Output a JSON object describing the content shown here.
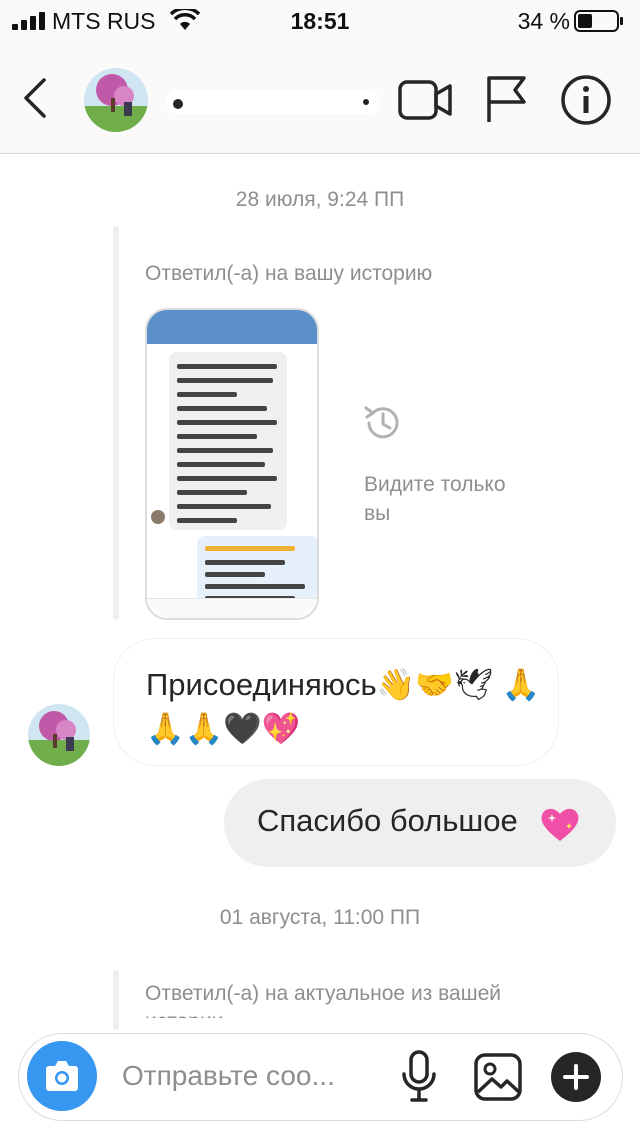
{
  "status_bar": {
    "carrier": "MTS RUS",
    "time": "18:51",
    "battery": "34 %"
  },
  "header": {
    "username": "",
    "icons": [
      "back-icon",
      "video-call-icon",
      "flag-icon",
      "info-icon"
    ]
  },
  "thread": {
    "date_1": "28 июля, 9:24 ПП",
    "story_reply_label": "Ответил(-а) на вашу историю",
    "only_you_see": "Видите только вы",
    "incoming_message": "Присоединяюсь👋🤝🕊 🙏🙏🙏🖤💖",
    "outgoing_message": "Спасибо большое",
    "date_2": "01 августа, 11:00 ПП",
    "highlight_reply_label": "Ответил(-а) на актуальное из вашей истории"
  },
  "composer": {
    "placeholder": "Отправьте соо..."
  },
  "colors": {
    "accent": "#3897f0",
    "bubble_out": "#efefef",
    "muted_text": "#8e8e8e",
    "divider": "#dbdbdb"
  }
}
